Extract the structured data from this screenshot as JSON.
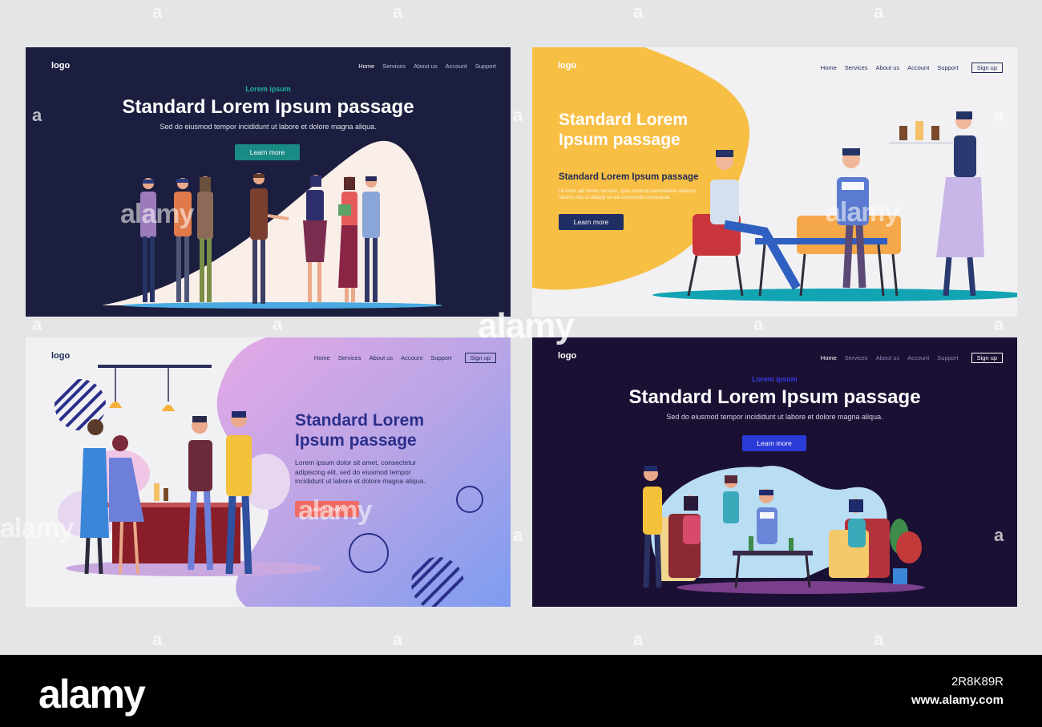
{
  "panels": [
    {
      "logo": "logo",
      "nav": [
        "Home",
        "Services",
        "About us",
        "Account",
        "Support"
      ],
      "kicker": "Lorem ipsum",
      "title": "Standard Lorem Ipsum passage",
      "desc": "Sed do eiusmod tempor incididunt ut labore et dolore magna aliqua.",
      "button": "Learn more"
    },
    {
      "logo": "logo",
      "nav": [
        "Home",
        "Services",
        "About us",
        "Account",
        "Support"
      ],
      "signup": "Sign up",
      "title_line1": "Standard Lorem",
      "title_line2": "Ipsum passage",
      "subtitle": "Standard Lorem Ipsum passage",
      "desc_line1": "Ut enim ad minim veniam, quis nostrud exercitation ullamco",
      "desc_line2": "laboris nisi ut aliquip ex ea commodo consequat.",
      "button": "Learn more"
    },
    {
      "logo": "logo",
      "nav": [
        "Home",
        "Services",
        "About us",
        "Account",
        "Support"
      ],
      "signup": "Sign up",
      "title_line1": "Standard Lorem",
      "title_line2": "Ipsum passage",
      "desc_line1": "Lorem ipsum dolor sit amet, consectetur",
      "desc_line2": "adipiscing elit, sed do eiusmod tempor",
      "desc_line3": "incididunt ut labore et dolore magna aliqua.",
      "button": "Learn more"
    },
    {
      "logo": "logo",
      "nav": [
        "Home",
        "Services",
        "About us",
        "Account",
        "Support"
      ],
      "signup": "Sign up",
      "kicker": "Lorem ipsum",
      "title": "Standard Lorem Ipsum passage",
      "desc": "Sed do eiusmod tempor incididunt ut labore et dolore magna aliqua.",
      "button": "Learn more"
    }
  ],
  "colors": {
    "teal": "#1a8a85",
    "navy": "#1f2e63",
    "coral": "#f06a63",
    "blue": "#2b3bd8",
    "yellow": "#f8bf45"
  },
  "watermark": "alamy",
  "footer": {
    "logo": "alamy",
    "image_id": "2R8K89R",
    "url": "www.alamy.com"
  }
}
